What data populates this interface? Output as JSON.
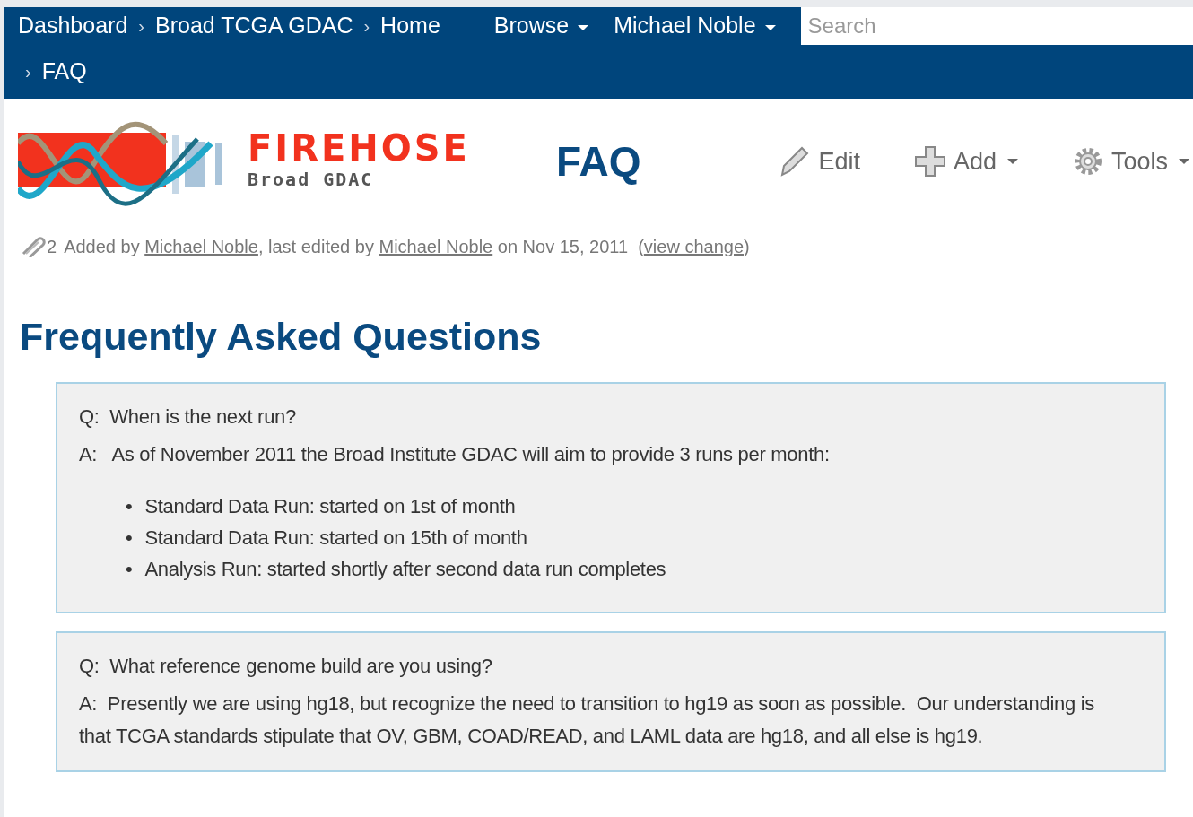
{
  "navbar": {
    "separator": "›",
    "breadcrumbs": [
      {
        "label": "Dashboard"
      },
      {
        "label": "Broad TCGA GDAC"
      },
      {
        "label": "Home"
      }
    ],
    "menus": [
      {
        "label": "Browse"
      },
      {
        "label": "Michael Noble"
      }
    ],
    "search": {
      "placeholder": "Search"
    },
    "current_page": {
      "label": "FAQ"
    }
  },
  "logo": {
    "title": "FIREHOSE",
    "subtitle": "Broad GDAC"
  },
  "page_title": "FAQ",
  "actions": [
    {
      "kind": "edit",
      "label": "Edit",
      "dropdown": false
    },
    {
      "kind": "add",
      "label": "Add",
      "dropdown": true
    },
    {
      "kind": "tools",
      "label": "Tools",
      "dropdown": true
    }
  ],
  "meta": {
    "attachments": "2",
    "parts": [
      {
        "kind": "text",
        "text": "Added by "
      },
      {
        "kind": "link",
        "text": "Michael Noble"
      },
      {
        "kind": "text",
        "text": ", last edited by "
      },
      {
        "kind": "link",
        "text": "Michael Noble"
      },
      {
        "kind": "text",
        "text": " on Nov 15, 2011  ("
      },
      {
        "kind": "link",
        "text": "view change"
      },
      {
        "kind": "text",
        "text": ")"
      }
    ]
  },
  "heading": "Frequently Asked Questions",
  "faqs": [
    {
      "question": "Q:  When is the next run?",
      "answer": "A:   As of November 2011 the Broad Institute GDAC will aim to provide 3 runs per month:",
      "bullet": "•",
      "bullets": [
        "Standard Data Run: started on 1st of month",
        "Standard Data Run: started on 15th of month",
        "Analysis Run: started shortly after second data run completes"
      ]
    },
    {
      "question": "Q:  What reference genome build are you using?",
      "answer": "A:  Presently we are using hg18, but recognize the need to transition to hg19 as soon as possible.  Our understanding is that TCGA standards stipulate that OV, GBM, COAD/READ, and LAML data are hg18, and all else is hg19."
    }
  ]
}
